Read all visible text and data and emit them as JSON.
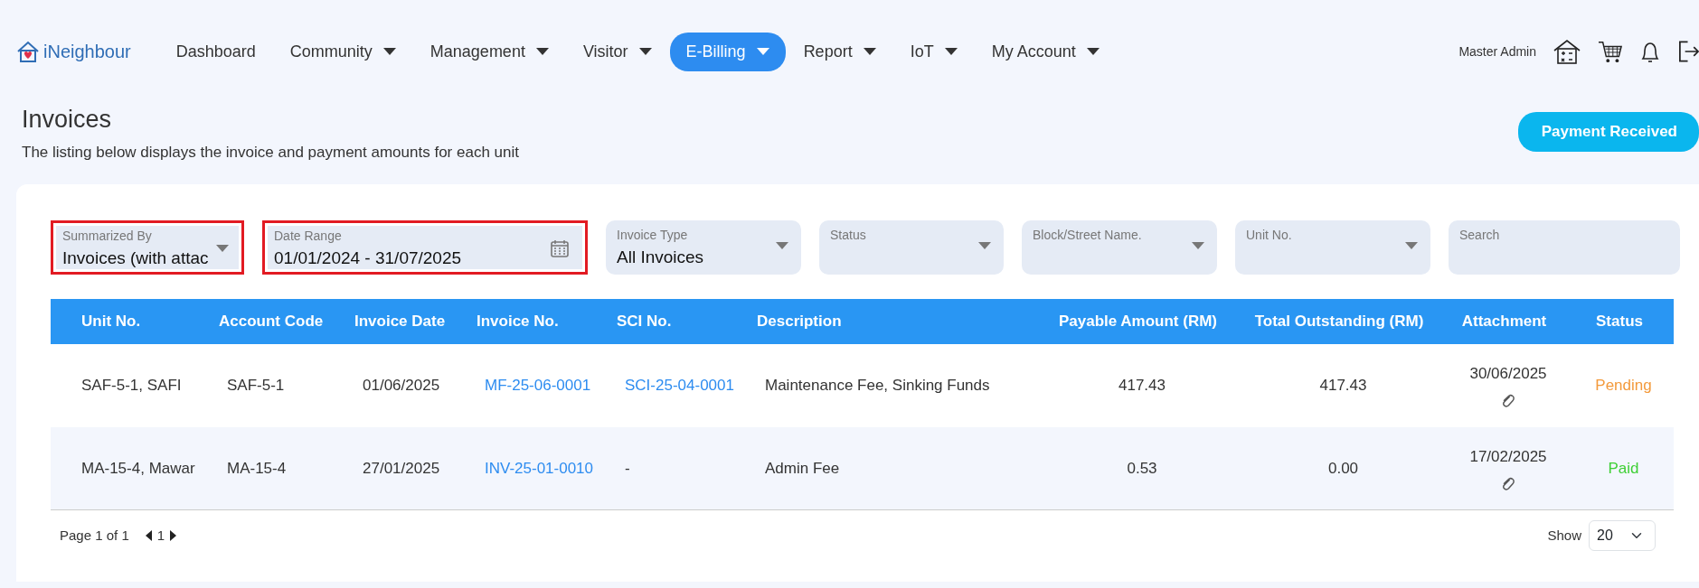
{
  "brand": {
    "name": "iNeighbour"
  },
  "nav": [
    {
      "label": "Dashboard",
      "dropdown": false,
      "selected": false
    },
    {
      "label": "Community",
      "dropdown": true,
      "selected": false
    },
    {
      "label": "Management",
      "dropdown": true,
      "selected": false
    },
    {
      "label": "Visitor",
      "dropdown": true,
      "selected": false
    },
    {
      "label": "E-Billing",
      "dropdown": true,
      "selected": true
    },
    {
      "label": "Report",
      "dropdown": true,
      "selected": false
    },
    {
      "label": "IoT",
      "dropdown": true,
      "selected": false
    },
    {
      "label": "My Account",
      "dropdown": true,
      "selected": false
    }
  ],
  "user": {
    "name": "Master Admin"
  },
  "page": {
    "title": "Invoices",
    "subtitle": "The listing below displays the invoice and payment amounts for each unit",
    "action": "Payment Received"
  },
  "filters": [
    {
      "kind": "select",
      "label": "Summarized By",
      "value": "Invoices (with attac",
      "highlighted": true
    },
    {
      "kind": "date",
      "label": "Date Range",
      "value": "01/01/2024 - 31/07/2025",
      "highlighted": true
    },
    {
      "kind": "select",
      "label": "Invoice Type",
      "value": "All Invoices",
      "highlighted": false
    },
    {
      "kind": "select",
      "label": "Status",
      "highlighted": false
    },
    {
      "kind": "select",
      "label": "Block/Street Name.",
      "highlighted": false
    },
    {
      "kind": "select",
      "label": "Unit No.",
      "highlighted": false
    },
    {
      "kind": "search",
      "label": "Search",
      "highlighted": false
    }
  ],
  "table": {
    "columns": [
      "Unit No.",
      "Account Code",
      "Invoice Date",
      "Invoice No.",
      "SCI No.",
      "Description",
      "Payable Amount (RM)",
      "Total Outstanding (RM)",
      "Attachment",
      "Status"
    ],
    "rows": [
      {
        "unit": "SAF-5-1, SAFI",
        "account": "SAF-5-1",
        "date": "01/06/2025",
        "invoice_no": "MF-25-06-0001",
        "sci_no": "SCI-25-04-0001",
        "sci_link": true,
        "description": "Maintenance Fee, Sinking Funds",
        "payable": "417.43",
        "outstanding": "417.43",
        "attachment_date": "30/06/2025",
        "status": "Pending",
        "color": "#f39a3c"
      },
      {
        "unit": "MA-15-4, Mawar",
        "account": "MA-15-4",
        "date": "27/01/2025",
        "invoice_no": "INV-25-01-0010",
        "sci_no": "-",
        "sci_link": false,
        "description": "Admin Fee",
        "payable": "0.53",
        "outstanding": "0.00",
        "attachment_date": "17/02/2025",
        "status": "Paid",
        "color": "#3ecf35"
      }
    ]
  },
  "pagination": {
    "summary": "Page 1 of 1",
    "page": "1",
    "show_label": "Show",
    "page_size": "20"
  }
}
